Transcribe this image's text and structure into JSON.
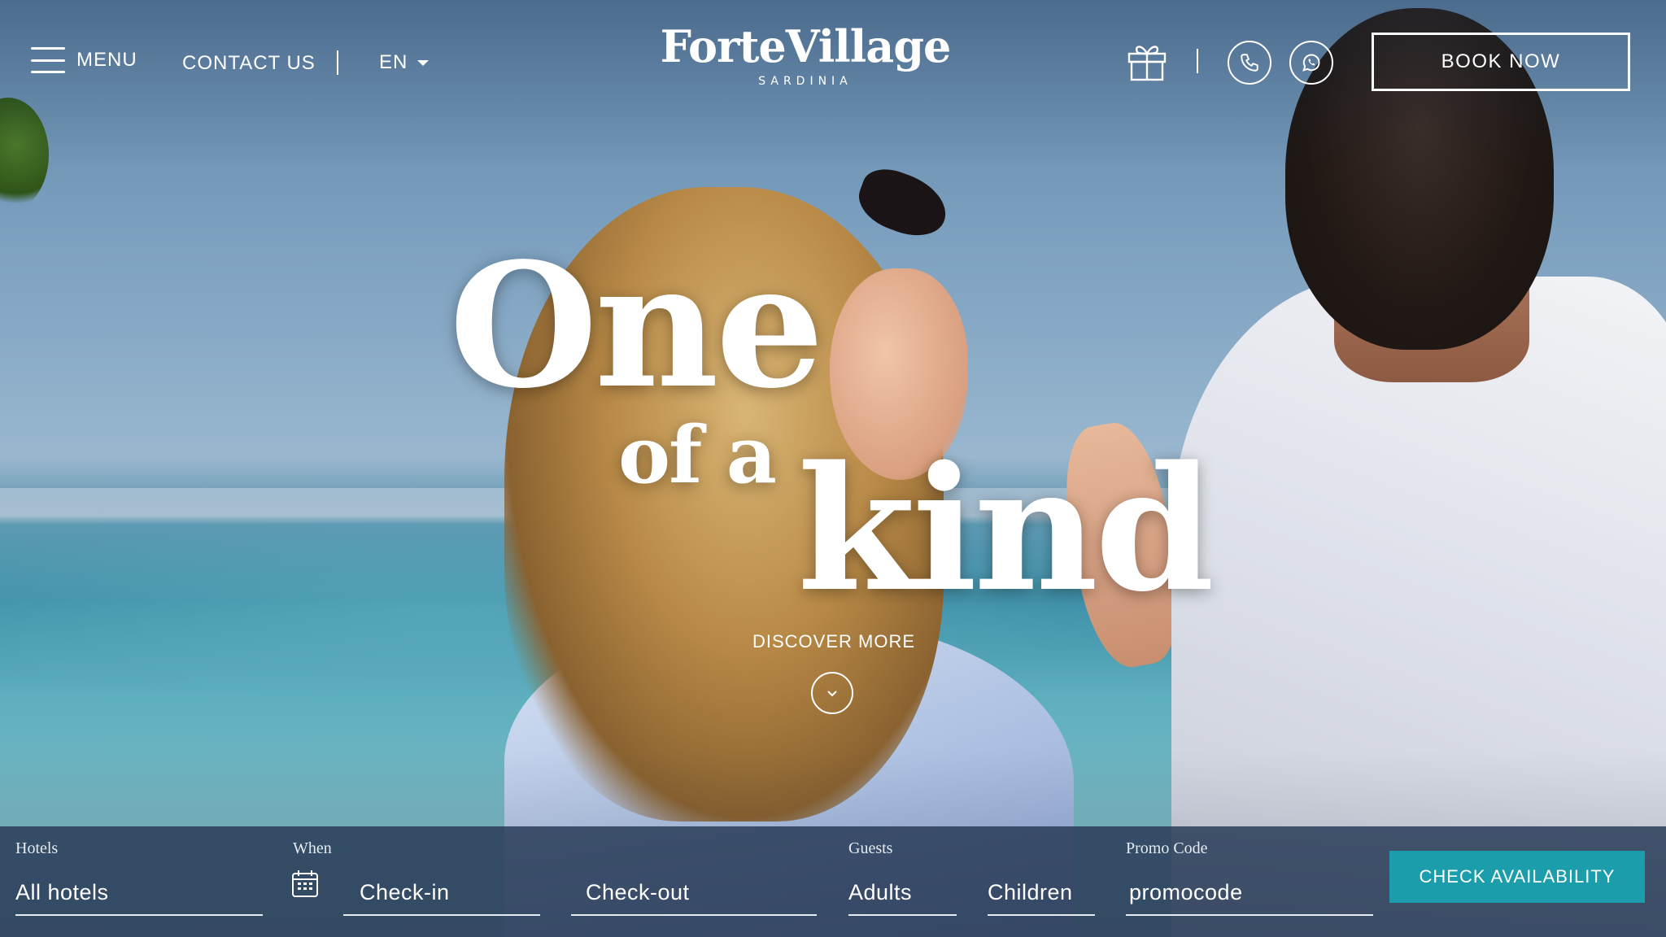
{
  "header": {
    "menu_label": "MENU",
    "contact_label": "CONTACT US",
    "language": "EN",
    "logo_title": "ForteVillage",
    "logo_subtitle": "SARDINIA",
    "book_label": "BOOK NOW"
  },
  "hero": {
    "line1": "One",
    "line2": "of a",
    "line3": "kind",
    "discover_label": "DISCOVER MORE"
  },
  "booking": {
    "hotels_label": "Hotels",
    "hotels_value": "All hotels",
    "when_label": "When",
    "checkin_placeholder": "Check-in",
    "checkout_placeholder": "Check-out",
    "guests_label": "Guests",
    "adults_placeholder": "Adults",
    "children_placeholder": "Children",
    "promo_label": "Promo Code",
    "promo_placeholder": "promocode",
    "check_button": "CHECK AVAILABILITY"
  },
  "icons": [
    "menu-icon",
    "caret-down-icon",
    "gift-icon",
    "phone-icon",
    "whatsapp-icon",
    "chevron-down-icon",
    "calendar-icon"
  ],
  "colors": {
    "booking_bar": "#2a3c58",
    "accent_button": "#1b9dab",
    "text": "#ffffff"
  }
}
